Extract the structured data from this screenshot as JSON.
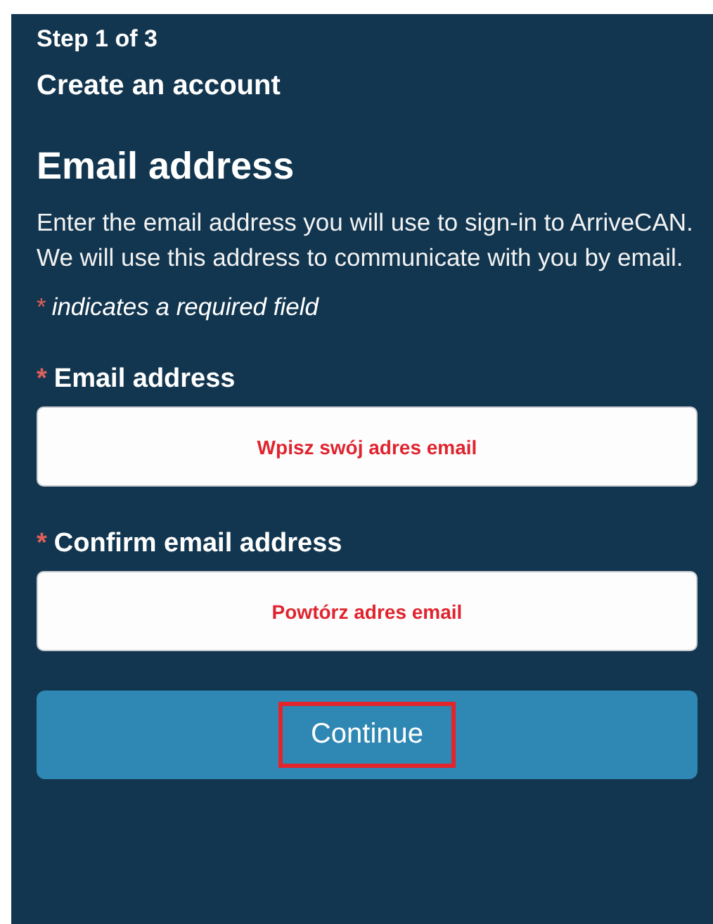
{
  "step": "Step 1 of 3",
  "page_title": "Create an account",
  "heading": "Email address",
  "intro": "Enter the email address you will use to sign-in to ArriveCAN. We will use this address to communicate with you by email.",
  "required_note": {
    "marker": "*",
    "text": "indicates a required field"
  },
  "fields": [
    {
      "marker": "*",
      "label": "Email address",
      "placeholder": "Wpisz swój adres email"
    },
    {
      "marker": "*",
      "label": "Confirm email address",
      "placeholder": "Powtórz adres email"
    }
  ],
  "continue_button": {
    "label": "Continue",
    "highlighted": true
  }
}
